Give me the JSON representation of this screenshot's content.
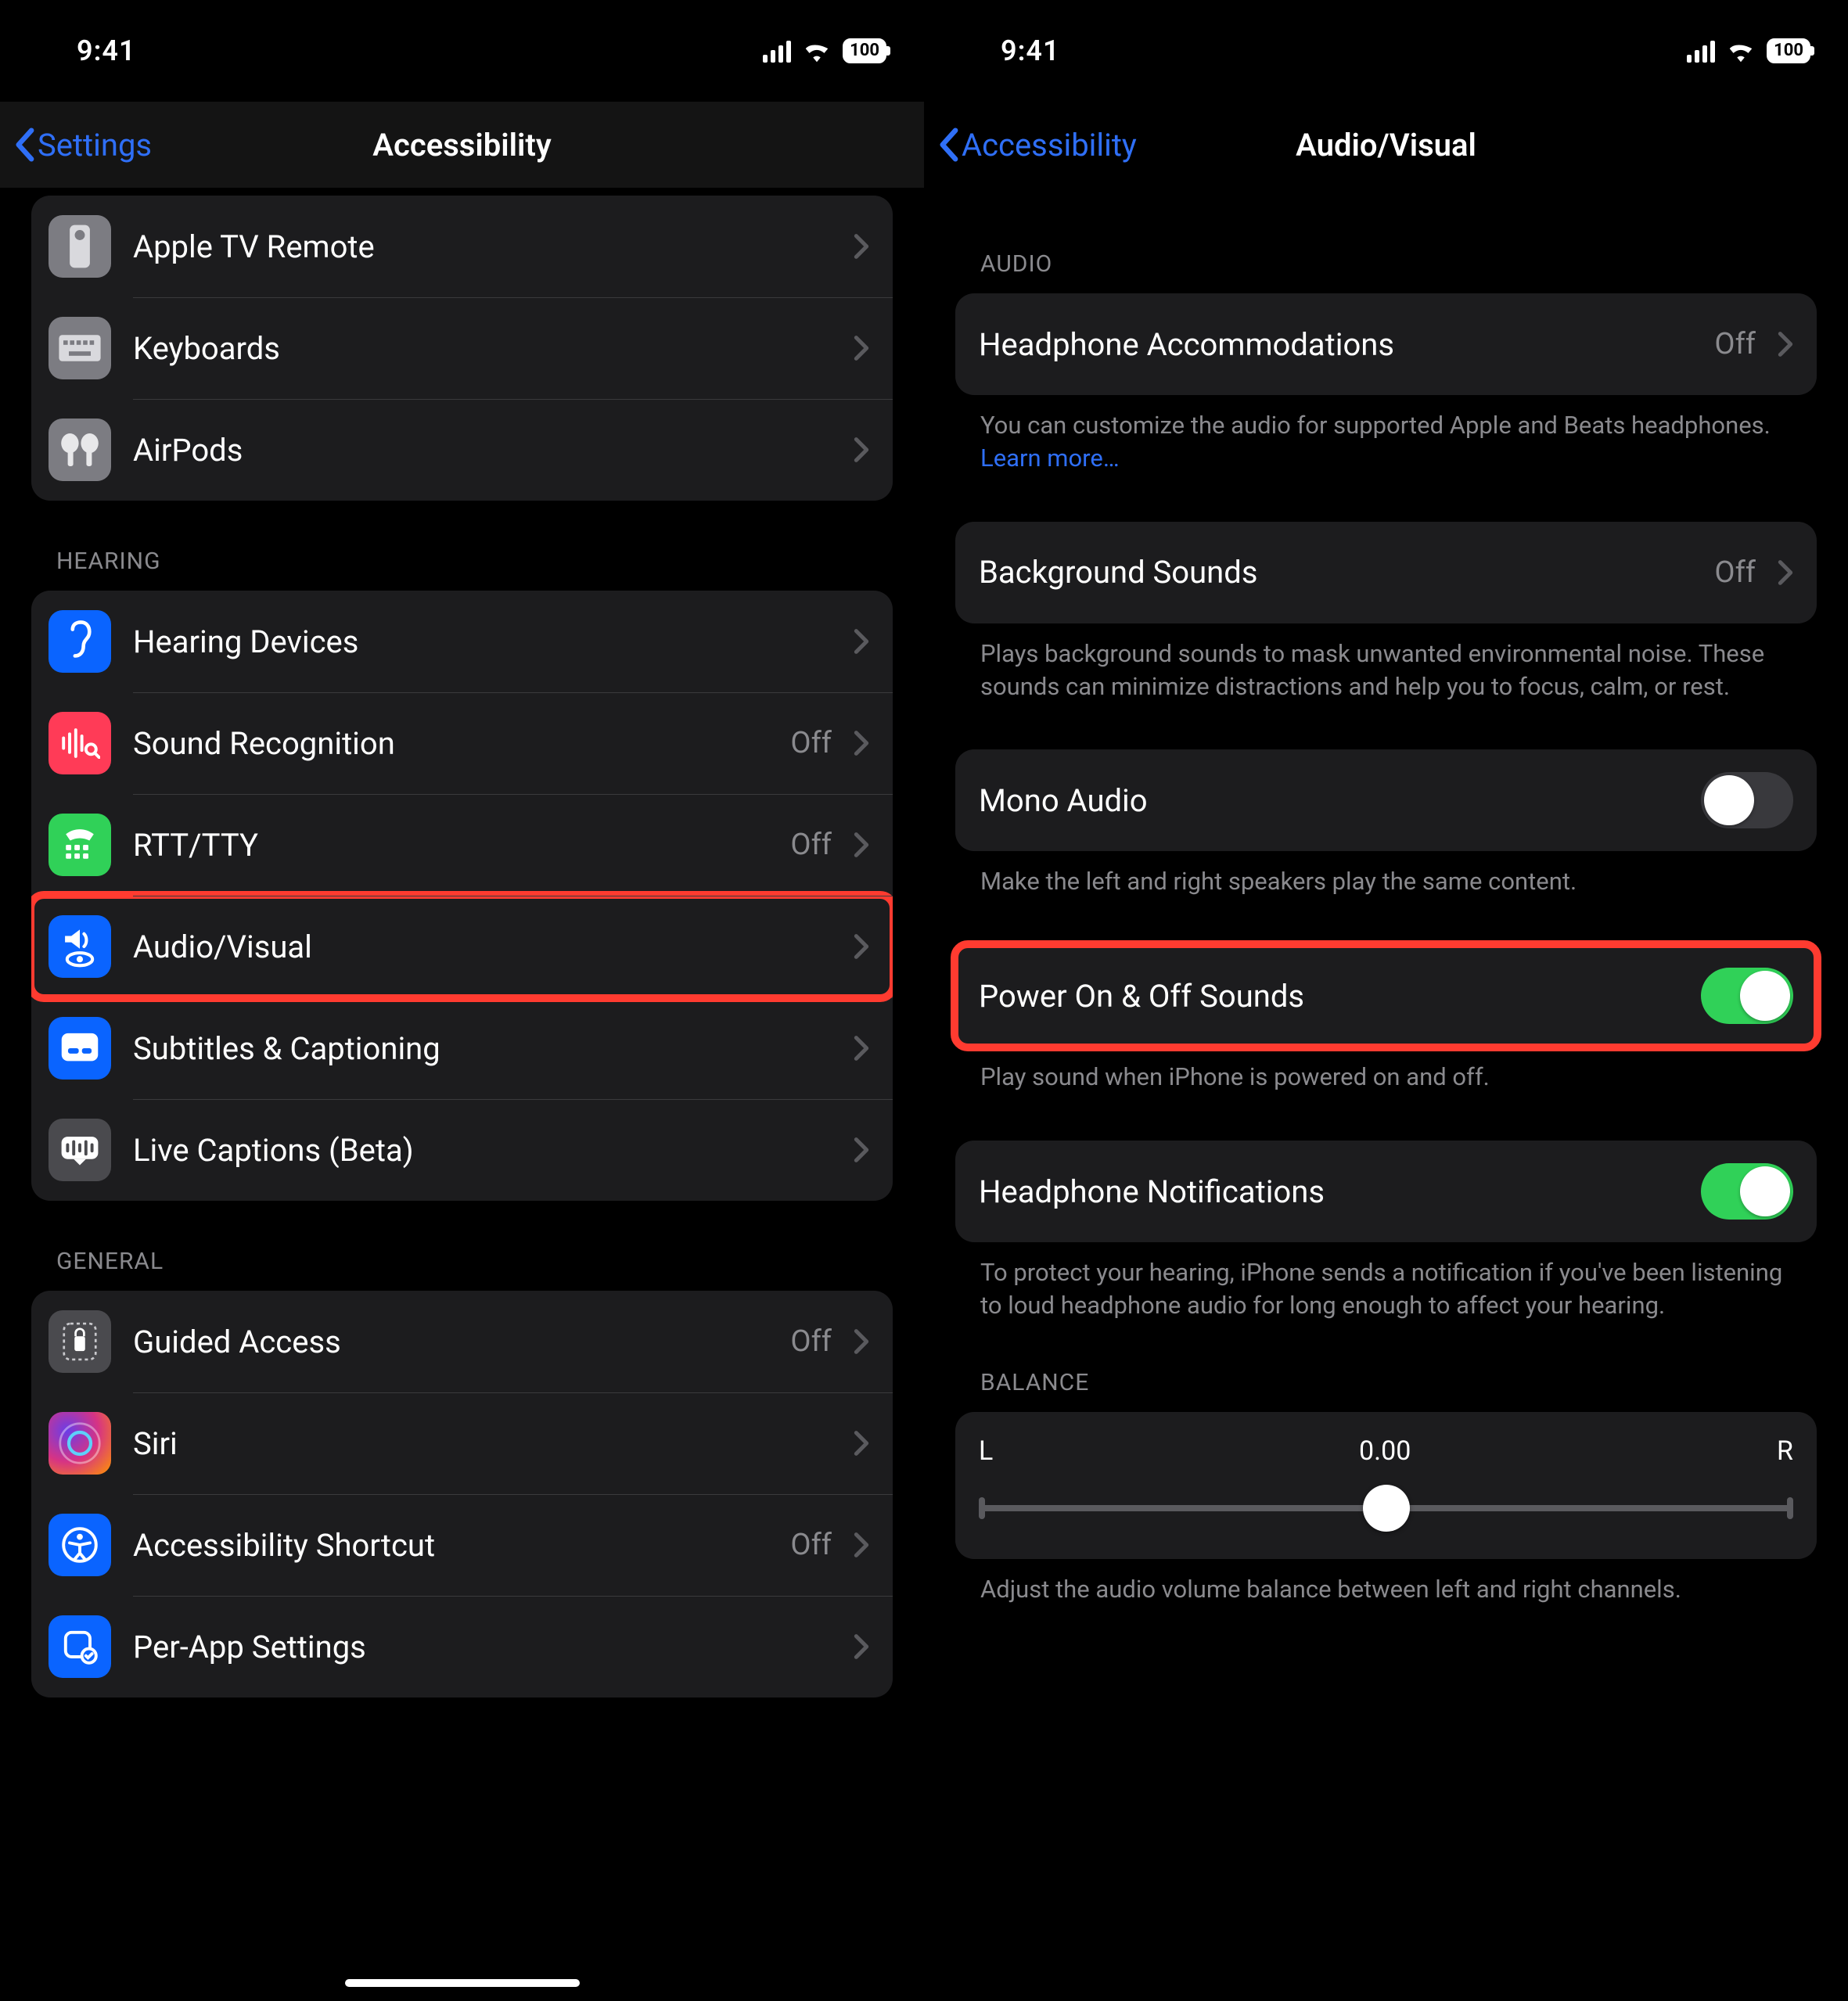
{
  "status": {
    "time": "9:41",
    "battery": "100"
  },
  "left": {
    "back_label": "Settings",
    "title": "Accessibility",
    "group_physical": [
      {
        "label": "Apple TV Remote"
      },
      {
        "label": "Keyboards"
      },
      {
        "label": "AirPods"
      }
    ],
    "hearing_header": "HEARING",
    "group_hearing": [
      {
        "label": "Hearing Devices",
        "value": ""
      },
      {
        "label": "Sound Recognition",
        "value": "Off"
      },
      {
        "label": "RTT/TTY",
        "value": "Off"
      },
      {
        "label": "Audio/Visual",
        "value": ""
      },
      {
        "label": "Subtitles & Captioning",
        "value": ""
      },
      {
        "label": "Live Captions (Beta)",
        "value": ""
      }
    ],
    "general_header": "GENERAL",
    "group_general": [
      {
        "label": "Guided Access",
        "value": "Off"
      },
      {
        "label": "Siri",
        "value": ""
      },
      {
        "label": "Accessibility Shortcut",
        "value": "Off"
      },
      {
        "label": "Per-App Settings",
        "value": ""
      }
    ]
  },
  "right": {
    "back_label": "Accessibility",
    "title": "Audio/Visual",
    "audio_header": "AUDIO",
    "headphone_accom": {
      "label": "Headphone Accommodations",
      "value": "Off"
    },
    "headphone_desc": "You can customize the audio for supported Apple and Beats headphones. ",
    "learn_more": "Learn more…",
    "background_sounds": {
      "label": "Background Sounds",
      "value": "Off"
    },
    "background_desc": "Plays background sounds to mask unwanted environmental noise. These sounds can minimize distractions and help you to focus, calm, or rest.",
    "mono_audio": {
      "label": "Mono Audio"
    },
    "mono_desc": "Make the left and right speakers play the same content.",
    "power_sounds": {
      "label": "Power On & Off Sounds"
    },
    "power_desc": "Play sound when iPhone is powered on and off.",
    "headphone_notif": {
      "label": "Headphone Notifications"
    },
    "headphone_notif_desc": "To protect your hearing, iPhone sends a notification if you've been listening to loud headphone audio for long enough to affect your hearing.",
    "balance_header": "BALANCE",
    "balance": {
      "left": "L",
      "right": "R",
      "value": "0.00"
    },
    "balance_desc": "Adjust the audio volume balance between left and right channels."
  }
}
